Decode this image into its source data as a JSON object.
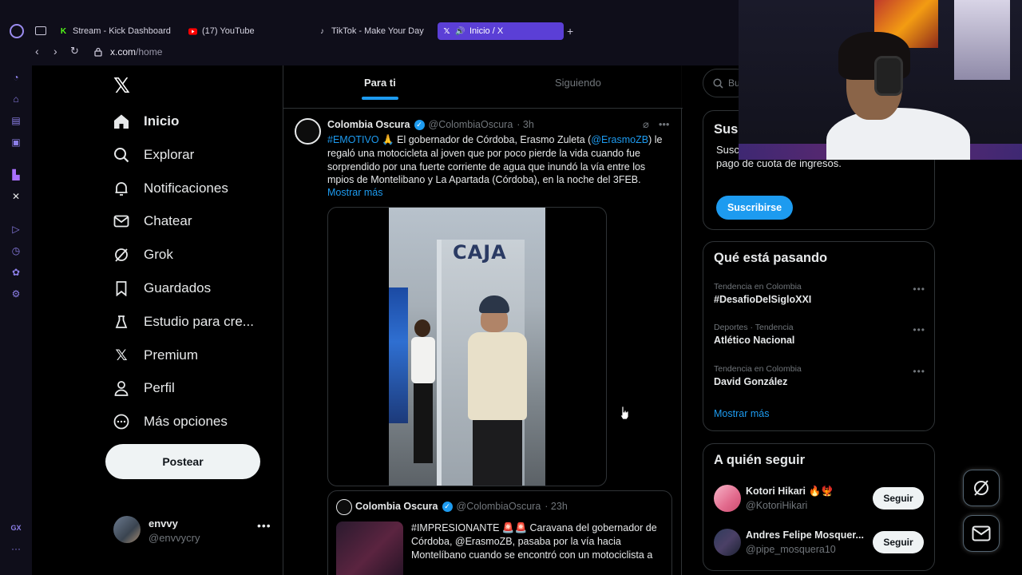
{
  "browser": {
    "tabs": [
      {
        "label": "Stream - Kick Dashboard",
        "icon": "kick-icon"
      },
      {
        "label": "(17) YouTube",
        "icon": "youtube-icon"
      },
      {
        "label": "TikTok - Make Your Day",
        "icon": "tiktok-icon"
      },
      {
        "label": "Inicio / X",
        "icon": "x-icon",
        "active": true
      }
    ],
    "address": {
      "domain": "x.com",
      "path": "/home"
    },
    "sidebar_label": "GX"
  },
  "nav": {
    "items": [
      {
        "label": "Inicio",
        "icon": "home-icon"
      },
      {
        "label": "Explorar",
        "icon": "search-icon"
      },
      {
        "label": "Notificaciones",
        "icon": "bell-icon"
      },
      {
        "label": "Chatear",
        "icon": "mail-icon"
      },
      {
        "label": "Grok",
        "icon": "grok-icon"
      },
      {
        "label": "Guardados",
        "icon": "bookmark-icon"
      },
      {
        "label": "Estudio para cre...",
        "icon": "studio-icon"
      },
      {
        "label": "Premium",
        "icon": "x-icon"
      },
      {
        "label": "Perfil",
        "icon": "person-icon"
      },
      {
        "label": "Más opciones",
        "icon": "more-circle-icon"
      }
    ],
    "post_button": "Postear",
    "profile": {
      "name": "envvy",
      "handle": "@envvycry"
    }
  },
  "feed": {
    "tabs": [
      "Para ti",
      "Siguiendo"
    ],
    "post": {
      "author": "Colombia Oscura",
      "handle": "@ColombiaOscura",
      "time": "· 3h",
      "hashtag": "#EMOTIVO",
      "emoji": "🙏",
      "text_a": " El gobernador de Córdoba, Erasmo Zuleta (",
      "mention": "@ErasmoZB",
      "text_b": ") le regaló una motocicleta al joven que por poco pierde la vida cuando fue sorprendido por una fuerte corriente de agua que inundó la vía entre los mpios de Montelibano y La Apartada (Córdoba), en la noche del 3FEB.",
      "show_more": "Mostrar más",
      "sign_text": "CAJA"
    },
    "quote": {
      "author": "Colombia Oscura",
      "handle": "@ColombiaOscura",
      "time": "· 23h",
      "text": "#IMPRESIONANTE 🚨🚨 Caravana del gobernador de Córdoba, @ErasmoZB, pasaba por la vía hacia Montelíbano cuando se encontró con un motociclista a"
    }
  },
  "right": {
    "search_placeholder": "Bus",
    "subscribe": {
      "title": "Sus",
      "text": "Susc funciones y, si eres elegible, recibir un pago de cuota de ingresos.",
      "button": "Suscribirse"
    },
    "trends": {
      "title": "Qué está pasando",
      "items": [
        {
          "meta": "Tendencia en Colombia",
          "topic": "#DesafioDelSigloXXI"
        },
        {
          "meta": "Deportes · Tendencia",
          "topic": "Atlético Nacional"
        },
        {
          "meta": "Tendencia en Colombia",
          "topic": "David González"
        }
      ],
      "show_more": "Mostrar más"
    },
    "follow": {
      "title": "A quién seguir",
      "items": [
        {
          "name": "Kotori Hikari 🔥🐦‍🔥",
          "handle": "@KotoriHikari",
          "button": "Seguir"
        },
        {
          "name": "Andres Felipe Mosquer...",
          "handle": "@pipe_mosquera10",
          "button": "Seguir"
        }
      ]
    }
  },
  "colors": {
    "accent": "#1d9bf0",
    "opera_tab": "#5b3fd6",
    "background": "#000000"
  }
}
